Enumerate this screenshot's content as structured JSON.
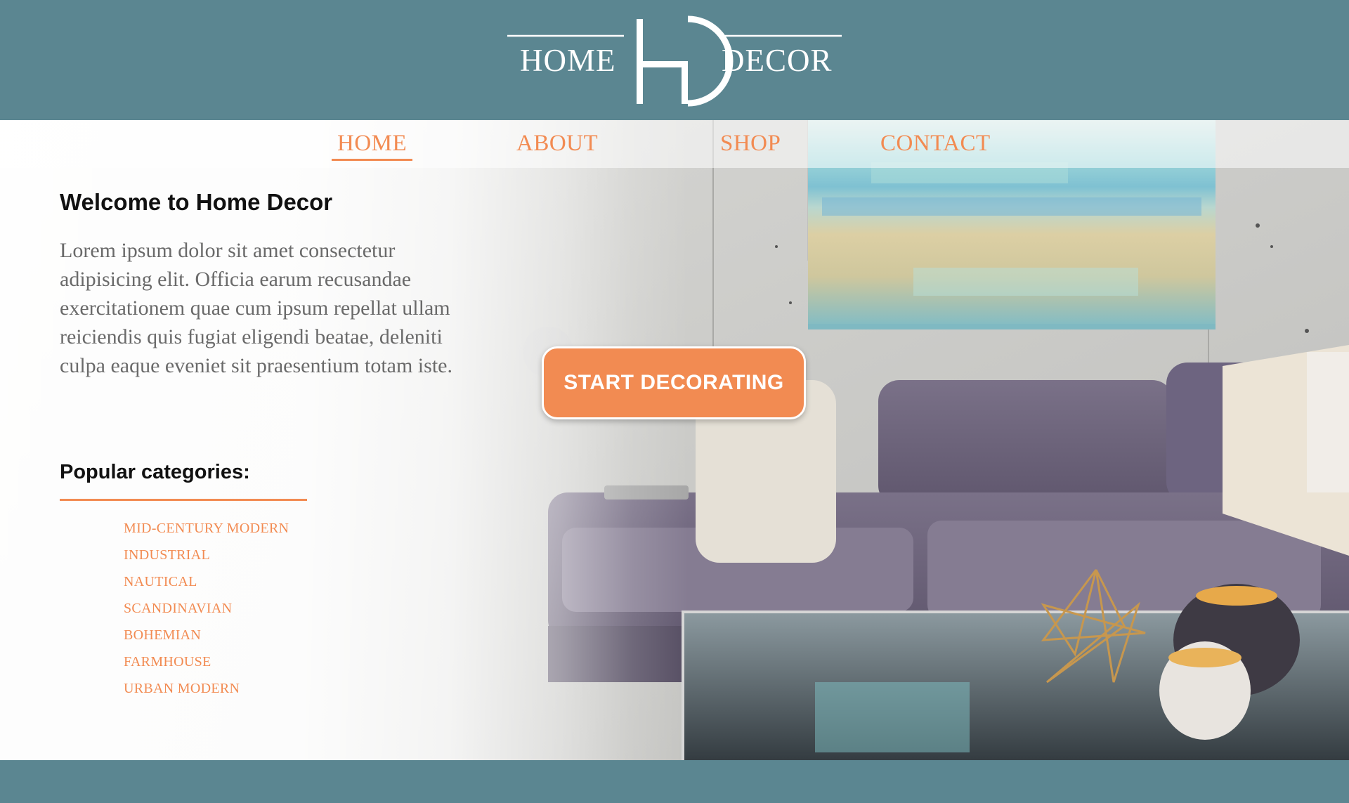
{
  "brand": {
    "left_word": "HOME",
    "right_word": "DECOR",
    "monogram": "HD"
  },
  "nav": {
    "items": [
      "HOME",
      "ABOUT",
      "SHOP",
      "CONTACT"
    ],
    "active": "HOME"
  },
  "hero": {
    "heading": "Welcome to Home Decor",
    "body": "Lorem ipsum dolor sit amet consectetur adipisicing elit. Officia earum recusandae exercitationem quae cum ipsum repellat ullam reiciendis quis fugiat eligendi beatae, deleniti culpa eaque eveniet sit praesentium totam iste.",
    "cta_label": "START DECORATING",
    "categories_title": "Popular categories:",
    "categories": [
      "MID-CENTURY MODERN",
      "INDUSTRIAL",
      "NAUTICAL",
      "SCANDINAVIAN",
      "BOHEMIAN",
      "FARMHOUSE",
      "URBAN MODERN"
    ]
  },
  "colors": {
    "header_bg": "#5b8691",
    "accent": "#f28b52",
    "text_dark": "#111111",
    "text_body": "#6a6a6a"
  }
}
